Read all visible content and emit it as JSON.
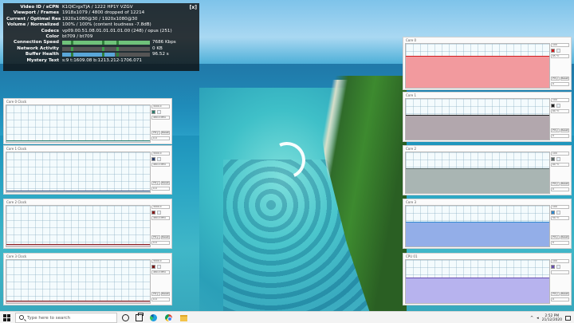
{
  "stats": {
    "close_label": "[x]",
    "rows": [
      {
        "key": "Video ID / sCPN",
        "value": "K1QlCrgxTjA / 1222 HP1Y VZGV"
      },
      {
        "key": "Viewport / Frames",
        "value": "1918x1079 / 4800 dropped of 12214"
      },
      {
        "key": "Current / Optimal Res",
        "value": "1920x1080@30 / 1920x1080@30"
      },
      {
        "key": "Volume / Normalized",
        "value": "100% / 100% (content loudness -7.8dB)"
      },
      {
        "key": "Codecs",
        "value": "vp09.00.51.08.01.01.01.01.00 (248) / opus (251)"
      },
      {
        "key": "Color",
        "value": "bt709 / bt709"
      },
      {
        "key": "Connection Speed",
        "value": "7686 Kbps",
        "level": 1.0,
        "color": "#6fc27a"
      },
      {
        "key": "Network Activity",
        "value": "0 KB",
        "level": 0.0,
        "color": "#6fc27a"
      },
      {
        "key": "Buffer Health",
        "value": "96.52 s",
        "level": 0.6,
        "color": "#5aa6d8"
      },
      {
        "key": "Mystery Text",
        "value": "s:9 t:1609.08 b:1213.212-1706.071"
      }
    ]
  },
  "widgets": [
    {
      "title": "Core 0 Clock",
      "v1": "3000.0",
      "v2": "480.0 MHz",
      "v3": "0.0",
      "btn_a": "Fit y",
      "btn_b": "Reset",
      "color": "#2e7d6e",
      "fill": "#cfe7ef",
      "level": 0.05
    },
    {
      "title": "Core 1 Clock",
      "v1": "3000.0",
      "v2": "480.0 MHz",
      "v3": "0.0",
      "btn_a": "Fit y",
      "btn_b": "Reset",
      "color": "#2a3f6e",
      "fill": "#cfe7ef",
      "level": 0.05
    },
    {
      "title": "Core 2 Clock",
      "v1": "3000.0",
      "v2": "480.0 MHz",
      "v3": "0.0",
      "btn_a": "Fit y",
      "btn_b": "Reset",
      "color": "#8b1d1d",
      "fill": "#e0c7cf",
      "level": 0.06
    },
    {
      "title": "Core 3 Clock",
      "v1": "3000.0",
      "v2": "480.0 MHz",
      "v3": "0.0",
      "btn_a": "Fit y",
      "btn_b": "Reset",
      "color": "#7a1414",
      "fill": "#e0c7cf",
      "level": 0.05
    },
    {
      "title": "Core 0",
      "v1": "100",
      "v2": "65 °C",
      "v3": "0",
      "btn_a": "Fit y",
      "btn_b": "Reset",
      "color": "#d21e1e",
      "fill": "#f29a9e",
      "level": 0.72
    },
    {
      "title": "Core 1",
      "v1": "100",
      "v2": "60 °C",
      "v3": "0",
      "btn_a": "Fit y",
      "btn_b": "Reset",
      "color": "#202020",
      "fill": "#b2a7ad",
      "level": 0.6
    },
    {
      "title": "Core 2",
      "v1": "100",
      "v2": "60 °C",
      "v3": "0",
      "btn_a": "Fit y",
      "btn_b": "Reset",
      "color": "#5a6a6a",
      "fill": "#a9b5b3",
      "level": 0.6
    },
    {
      "title": "Core 3",
      "v1": "100",
      "v2": "59 °C",
      "v3": "0",
      "btn_a": "Fit y",
      "btn_b": "Reset",
      "color": "#2f8ad0",
      "fill": "#93aee8",
      "level": 0.6
    },
    {
      "title": "CPU 01",
      "v1": "100",
      "v2": "",
      "v3": "0",
      "btn_a": "Fit y",
      "btn_b": "Reset",
      "color": "#6a4fb0",
      "fill": "#b7b3ee",
      "level": 0.6
    }
  ],
  "watermark": {
    "line1": "",
    "line2": ""
  },
  "taskbar": {
    "search_placeholder": "Type here to search",
    "time": "2:52 PM",
    "date": "21/12/2020",
    "tray_chevron": "^",
    "tray_speaker": "◂"
  }
}
